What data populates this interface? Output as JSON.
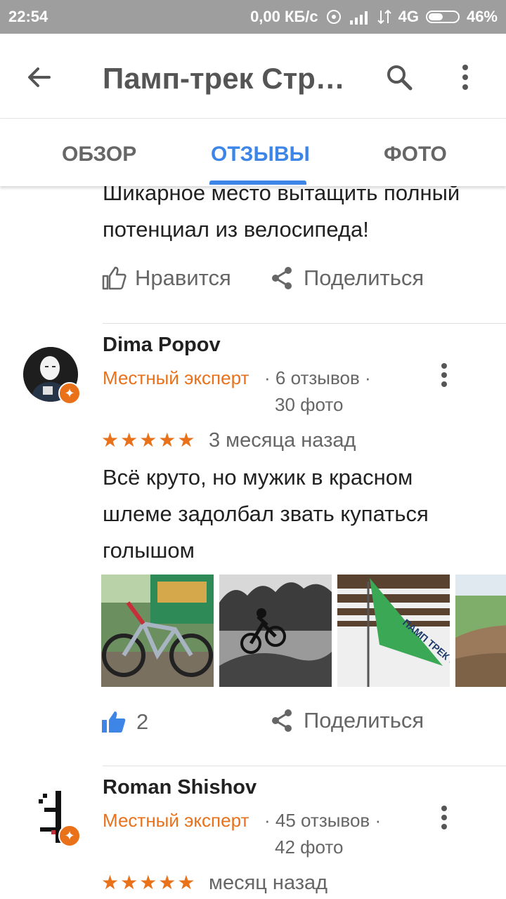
{
  "status": {
    "time": "22:54",
    "speed": "0,00 КБ/с",
    "network": "4G",
    "battery": "46%"
  },
  "appbar": {
    "title": "Памп-трек Стр…"
  },
  "tabs": [
    {
      "label": "ОБЗОР"
    },
    {
      "label": "ОТЗЫВЫ"
    },
    {
      "label": "ФОТО"
    }
  ],
  "previous_review": {
    "text": "Шикарное место вытащить полный потенциал из велосипеда!",
    "like_label": "Нравится",
    "share_label": "Поделиться"
  },
  "reviews": [
    {
      "name": "Dima Popov",
      "badge": "Местный эксперт",
      "reviews_count": "· 6 отзывов ·",
      "photos_count": "30 фото",
      "stars": "★★★★★",
      "rating": 5,
      "date": "3 месяца назад",
      "text": "Всё круто, но мужик в красном шлеме задолбал звать купаться голышом",
      "likes": "2",
      "share_label": "Поделиться"
    },
    {
      "name": "Roman Shishov",
      "badge": "Местный эксперт",
      "reviews_count": "· 45 отзывов ·",
      "photos_count": "42 фото",
      "stars": "★★★★★",
      "rating": 5,
      "date": "месяц назад"
    }
  ],
  "photo_flag_text": "ПАМП ТРЕК СТРОГИНО",
  "colors": {
    "accent": "#3d86e8",
    "expert": "#e8711a",
    "statusbar": "#9e9e9e"
  }
}
